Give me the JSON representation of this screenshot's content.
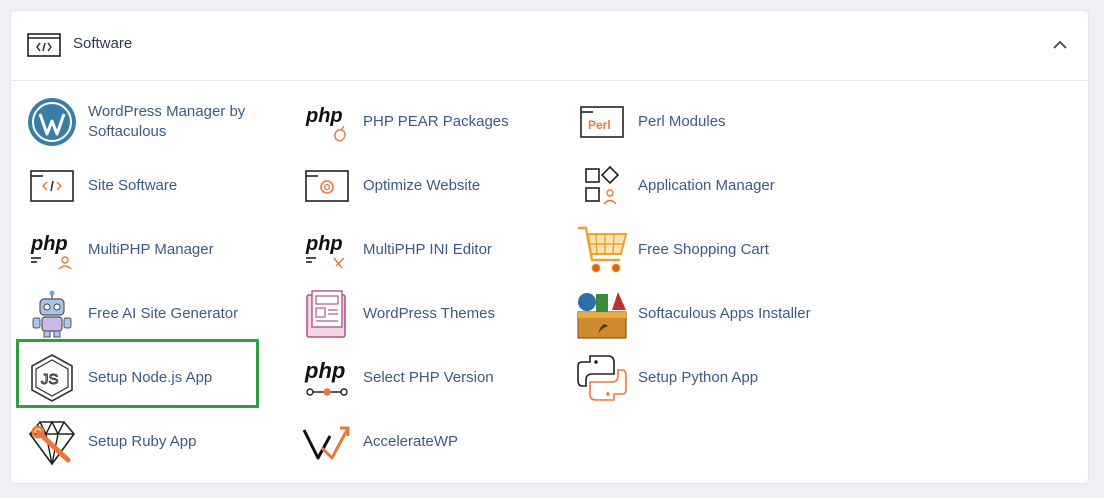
{
  "section": {
    "title": "Software",
    "icon": "code-window-icon",
    "collapse_icon": "chevron-up-icon"
  },
  "items": [
    {
      "label": "WordPress Manager by Softaculous",
      "icon": "wordpress-icon"
    },
    {
      "label": "PHP PEAR Packages",
      "icon": "php-pear-icon"
    },
    {
      "label": "Perl Modules",
      "icon": "perl-icon"
    },
    {
      "label": "Site Software",
      "icon": "code-window-icon"
    },
    {
      "label": "Optimize Website",
      "icon": "gear-window-icon"
    },
    {
      "label": "Application Manager",
      "icon": "app-grid-icon"
    },
    {
      "label": "MultiPHP Manager",
      "icon": "multiphp-manager-icon"
    },
    {
      "label": "MultiPHP INI Editor",
      "icon": "multiphp-ini-icon"
    },
    {
      "label": "Free Shopping Cart",
      "icon": "shopping-cart-icon"
    },
    {
      "label": "Free AI Site Generator",
      "icon": "robot-icon"
    },
    {
      "label": "WordPress Themes",
      "icon": "themes-icon"
    },
    {
      "label": "Softaculous Apps Installer",
      "icon": "softaculous-icon"
    },
    {
      "label": "Setup Node.js App",
      "icon": "nodejs-icon"
    },
    {
      "label": "Select PHP Version",
      "icon": "php-version-icon"
    },
    {
      "label": "Setup Python App",
      "icon": "python-icon"
    },
    {
      "label": "Setup Ruby App",
      "icon": "ruby-icon"
    },
    {
      "label": "AccelerateWP",
      "icon": "acceleratewp-icon"
    }
  ],
  "icon_text": {
    "php": "php",
    "perl": "Perl",
    "js": "JS"
  },
  "colors": {
    "accent_orange": "#e8793a",
    "link_blue": "#3c5a86",
    "highlight_green": "#2ea043"
  }
}
